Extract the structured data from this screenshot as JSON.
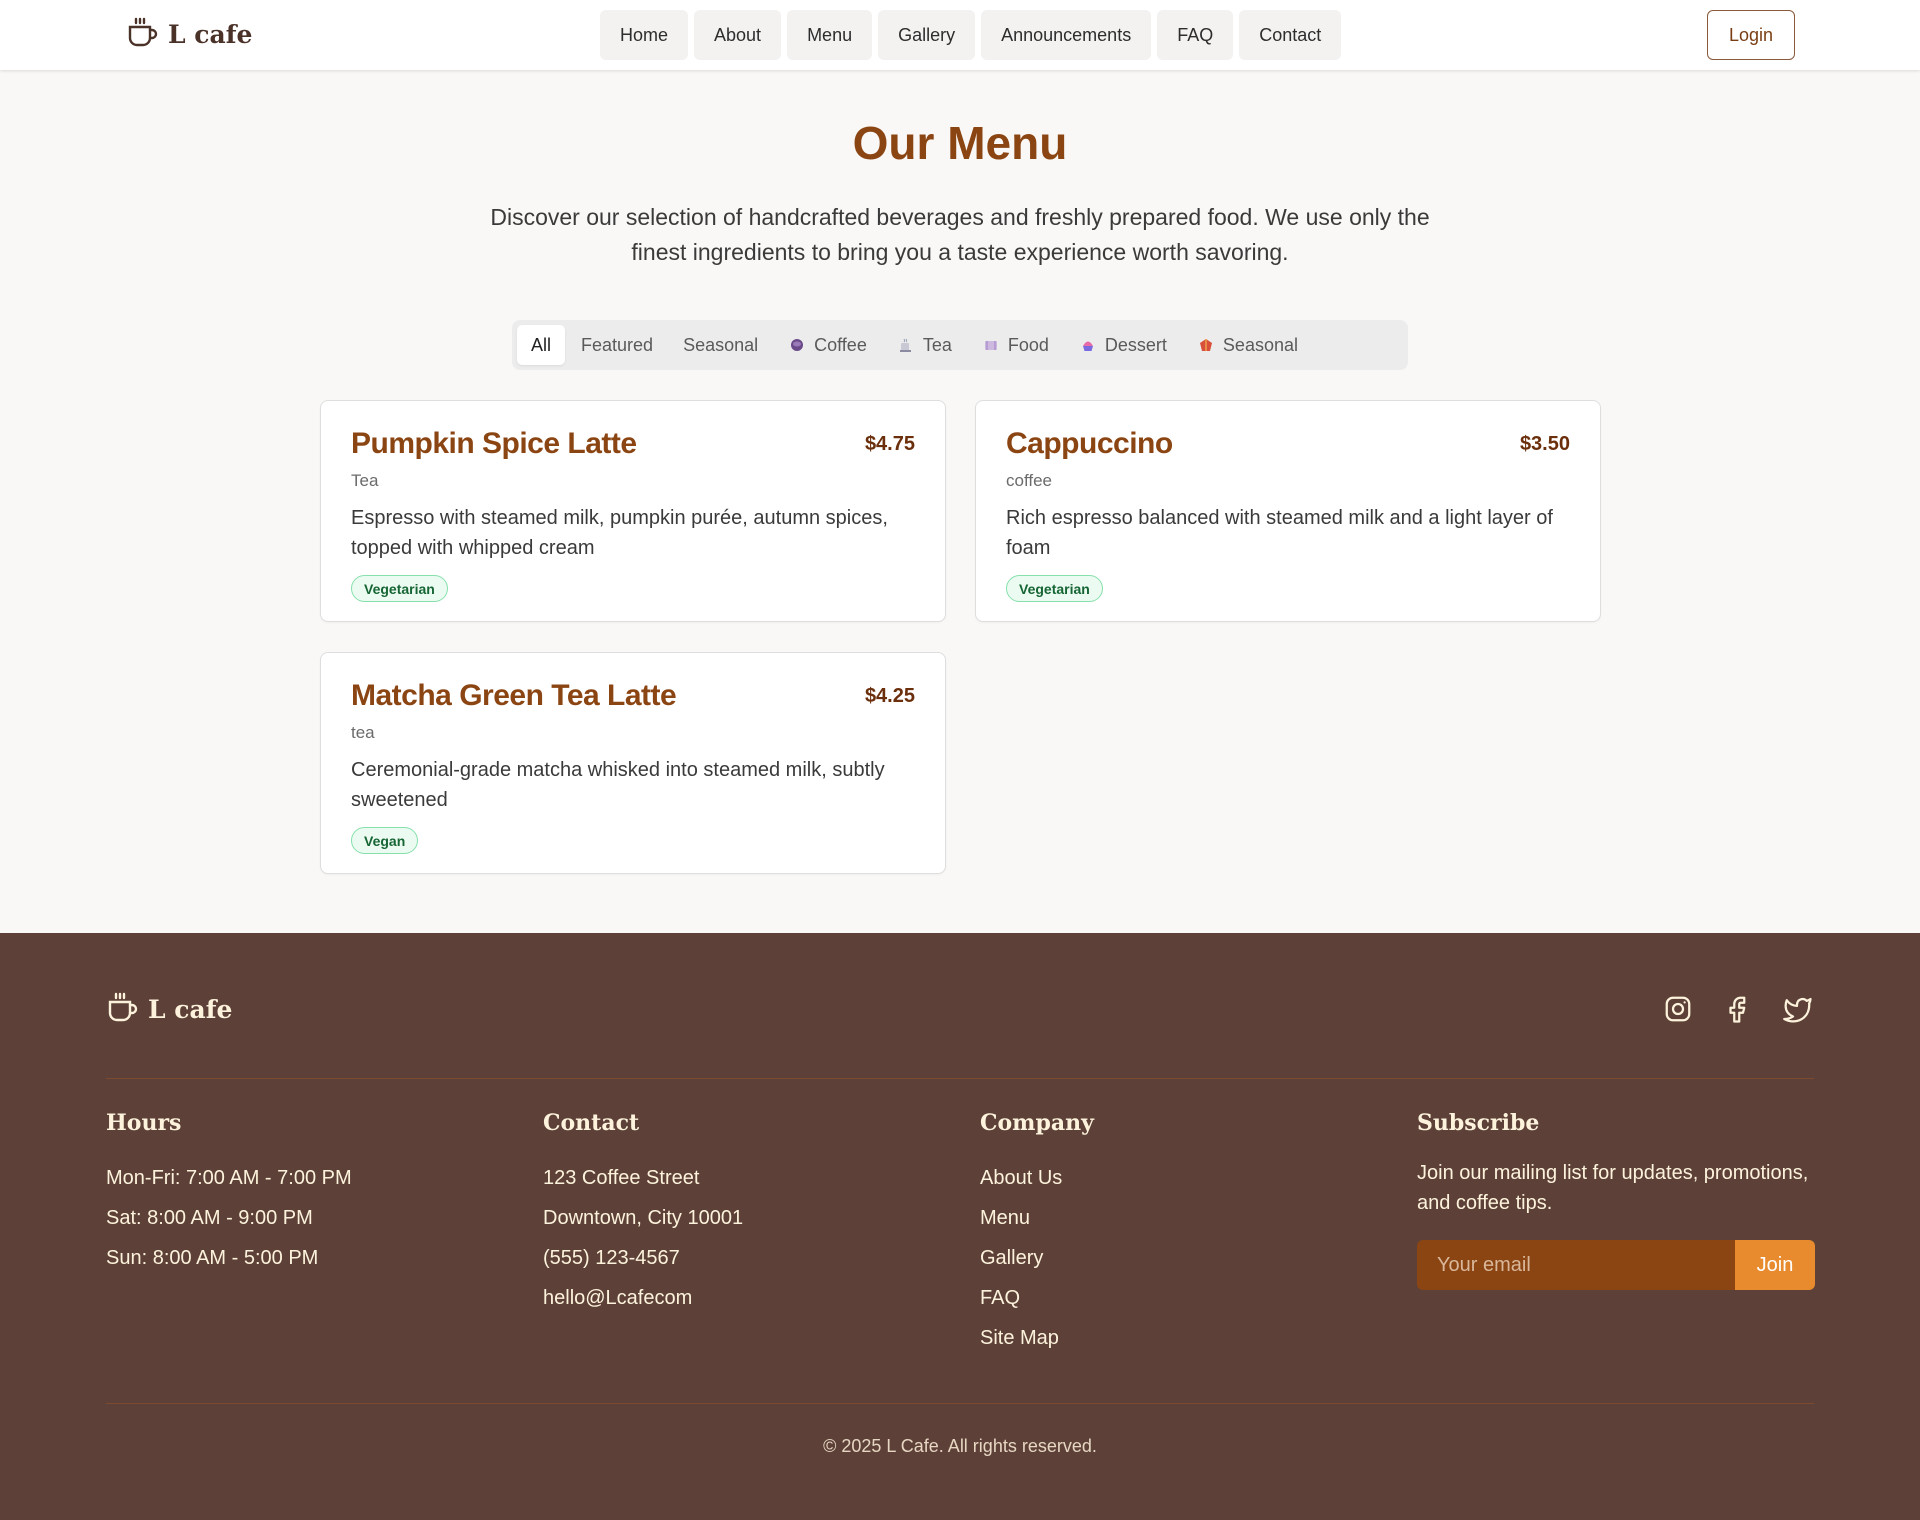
{
  "header": {
    "brand": "L cafe",
    "brand_icon": "coffee-cup-icon",
    "nav": [
      "Home",
      "About",
      "Menu",
      "Gallery",
      "Announcements",
      "FAQ",
      "Contact"
    ],
    "login_label": "Login"
  },
  "main": {
    "title": "Our Menu",
    "intro": "Discover our selection of handcrafted beverages and freshly prepared food. We use only the finest ingredients to bring you a taste experience worth savoring.",
    "filters": [
      {
        "label": "All",
        "icon": "",
        "active": true
      },
      {
        "label": "Featured",
        "icon": ""
      },
      {
        "label": "Seasonal",
        "icon": ""
      },
      {
        "label": "Coffee",
        "icon": "coffee-icon"
      },
      {
        "label": "Tea",
        "icon": "tea-icon"
      },
      {
        "label": "Food",
        "icon": "food-icon"
      },
      {
        "label": "Dessert",
        "icon": "dessert-icon"
      },
      {
        "label": "Seasonal",
        "icon": "seasonal-icon"
      }
    ],
    "items": [
      {
        "name": "Pumpkin Spice Latte",
        "price": "$4.75",
        "category": "Tea",
        "description": "Espresso with steamed milk, pumpkin purée, autumn spices, topped with whipped cream",
        "tag": "Vegetarian"
      },
      {
        "name": "Cappuccino",
        "price": "$3.50",
        "category": "coffee",
        "description": "Rich espresso balanced with steamed milk and a light layer of foam",
        "tag": "Vegetarian"
      },
      {
        "name": "Matcha Green Tea Latte",
        "price": "$4.25",
        "category": "tea",
        "description": "Ceremonial-grade matcha whisked into steamed milk, subtly sweetened",
        "tag": "Vegan"
      }
    ]
  },
  "footer": {
    "brand": "L cafe",
    "socials": [
      "instagram-icon",
      "facebook-icon",
      "twitter-icon"
    ],
    "hours": {
      "title": "Hours",
      "lines": [
        "Mon-Fri: 7:00 AM - 7:00 PM",
        "Sat: 8:00 AM - 9:00 PM",
        "Sun: 8:00 AM - 5:00 PM"
      ]
    },
    "contact": {
      "title": "Contact",
      "lines": [
        "123 Coffee Street",
        "Downtown, City 10001",
        "(555) 123-4567",
        "hello@Lcafecom"
      ]
    },
    "company": {
      "title": "Company",
      "links": [
        "About Us",
        "Menu",
        "Gallery",
        "FAQ",
        "Site Map"
      ]
    },
    "subscribe": {
      "title": "Subscribe",
      "text": "Join our mailing list for updates, promotions, and coffee tips.",
      "placeholder": "Your email",
      "button": "Join"
    },
    "copyright": "© 2025 L Cafe. All rights reserved."
  },
  "colors": {
    "accent": "#8b4513",
    "footer_bg": "#5d4037",
    "join_button": "#e88a2e",
    "tag_green": "#166534"
  }
}
